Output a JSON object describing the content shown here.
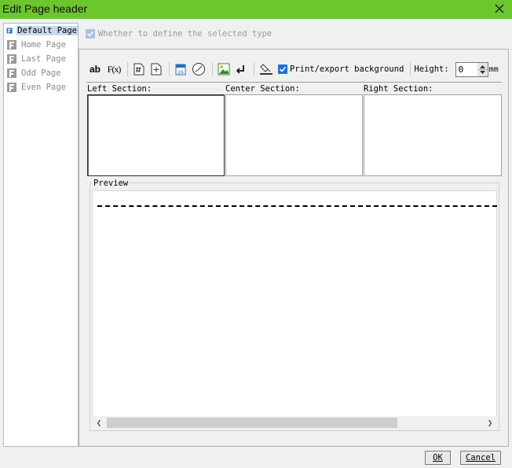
{
  "window": {
    "title": "Edit Page header"
  },
  "sidebar": {
    "items": [
      {
        "label": "Default Page",
        "selected": true
      },
      {
        "label": "Home Page",
        "selected": false
      },
      {
        "label": "Last Page",
        "selected": false
      },
      {
        "label": "Odd Page",
        "selected": false
      },
      {
        "label": "Even Page",
        "selected": false
      }
    ]
  },
  "define_type": {
    "label": "Whether to define the selected type",
    "checked": true,
    "enabled": false
  },
  "toolbar": {
    "text_button": "ab",
    "formula_button": "F(x)",
    "calendar_day": "26",
    "print_bg_label": "Print/export background",
    "print_bg_checked": true,
    "height_label": "Height:",
    "height_value": "0",
    "height_unit": "mm",
    "icons": [
      "text-icon",
      "formula-icon",
      "page-number-icon",
      "total-pages-icon",
      "date-icon",
      "time-icon",
      "image-icon",
      "line-break-icon",
      "format-icon"
    ]
  },
  "sections": {
    "left": "Left Section:",
    "center": "Center Section:",
    "right": "Right Section:"
  },
  "preview": {
    "label": "Preview"
  },
  "buttons": {
    "ok": "OK",
    "cancel": "Cancel"
  },
  "colors": {
    "titlebar": "#6cc62e",
    "accent": "#1a73d9",
    "selection": "#c9d9f0"
  }
}
